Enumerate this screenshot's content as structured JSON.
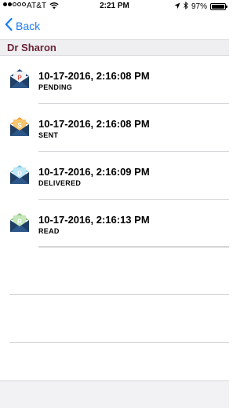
{
  "status_bar": {
    "carrier": "AT&T",
    "time": "2:21 PM",
    "battery_percent": "97%",
    "battery_level": 0.97,
    "signal_bars_filled": 2,
    "signal_bars_total": 5
  },
  "nav": {
    "back_label": "Back"
  },
  "section": {
    "title": "Dr Sharon"
  },
  "messages": [
    {
      "timestamp": "10-17-2016, 2:16:08 PM",
      "status": "PENDING",
      "letter": "P",
      "icon": "envelope-pending-icon",
      "flap_color": "#2b4f86",
      "card_color": "#f3f3f3",
      "letter_color": "#d9534f"
    },
    {
      "timestamp": "10-17-2016, 2:16:08 PM",
      "status": "SENT",
      "letter": "S",
      "icon": "envelope-sent-icon",
      "flap_color": "#f0a43a",
      "card_color": "#f6c76e",
      "letter_color": "#ffffff"
    },
    {
      "timestamp": "10-17-2016, 2:16:09 PM",
      "status": "DELIVERED",
      "letter": "D",
      "icon": "envelope-delivered-icon",
      "flap_color": "#7cc9e6",
      "card_color": "#bfe7f4",
      "letter_color": "#ffffff"
    },
    {
      "timestamp": "10-17-2016, 2:16:13 PM",
      "status": "READ",
      "letter": "R",
      "icon": "envelope-read-icon",
      "flap_color": "#8cc97d",
      "card_color": "#c4e6b9",
      "letter_color": "#ffffff"
    }
  ],
  "colors": {
    "accent": "#1a7cf5",
    "section_title": "#6b2436",
    "envelope_body": "#1f3f66"
  }
}
